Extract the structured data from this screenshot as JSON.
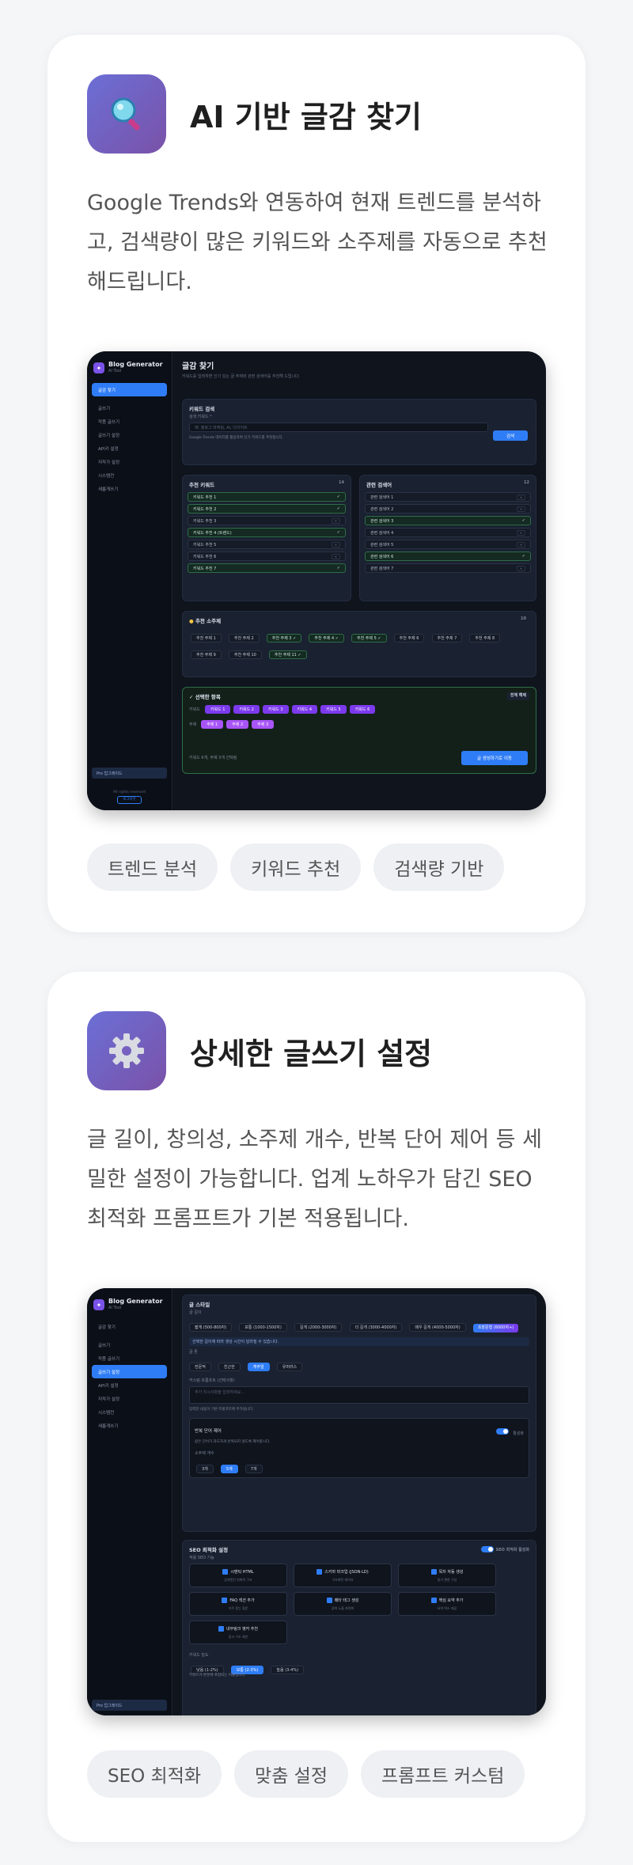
{
  "features": [
    {
      "icon": "magnifier-icon",
      "title": "AI 기반 글감 찾기",
      "description": "Google Trends와 연동하여 현재 트렌드를 분석하고, 검색량이 많은 키워드와 소주제를 자동으로 추천해드립니다.",
      "tags": [
        "트렌드 분석",
        "키워드 추천",
        "검색량 기반"
      ],
      "screenshot": {
        "app_name": "Blog Generator",
        "app_sub": "AI Tool",
        "sidebar": [
          "글감 찾기",
          "글쓰기",
          "작품 글쓰기",
          "글쓰기 설정",
          "API키 설정",
          "저작가 설정",
          "시스템전",
          "새롭게쓰기"
        ],
        "sidebar_active_index": 0,
        "sidebar_footer": "Pro 업그레이드",
        "sidebar_footer_note": "All rights reserved",
        "sidebar_footer_button": "로그아웃",
        "page_title": "글감 찾기",
        "page_subtitle": "키워드를 입력하면 인기 있는 글 주제와 관련 검색어를 추천해 드립니다.",
        "search_panel": {
          "title": "키워드 검색",
          "label": "검색 키워드 *",
          "placeholder": "예: 블로그 마케팅, AI, 다이어트",
          "button": "검색",
          "hint": "Google Trends 데이터를 활용하여 인기 키워드를 추천합니다."
        },
        "recommended": {
          "title": "추천 키워드",
          "count": "14",
          "items": [
            "키워드 추천 1",
            "키워드 추천 2",
            "키워드 추천 3",
            "키워드 추천 4 (트렌드)",
            "키워드 추천 5",
            "키워드 추천 6",
            "키워드 추천 7"
          ]
        },
        "related": {
          "title": "관련 검색어",
          "count": "12",
          "items": [
            "관련 검색어 1",
            "관련 검색어 2",
            "관련 검색어 3",
            "관련 검색어 4",
            "관련 검색어 5",
            "관련 검색어 6",
            "관련 검색어 7"
          ]
        },
        "subtopics": {
          "title": "추천 소주제",
          "count": "10",
          "items": [
            "추천 주제 1",
            "추천 주제 2",
            "추천 주제 3 ✓",
            "추천 주제 4 ✓",
            "추천 주제 5 ✓",
            "추천 주제 6",
            "추천 주제 7",
            "추천 주제 8",
            "추천 주제 9",
            "추천 주제 10",
            "추천 주제 11 ✓"
          ]
        },
        "selection": {
          "title": "선택한 항목",
          "clear": "전체 해제",
          "keyword_label": "키워드",
          "keywords": [
            "키워드 1",
            "키워드 2",
            "키워드 3",
            "키워드 4",
            "키워드 5",
            "키워드 6"
          ],
          "topic_label": "주제",
          "topics": [
            "주제 1",
            "주제 2",
            "주제 3"
          ],
          "summary": "키워드 6개, 주제 3개 선택됨",
          "generate": "글 생성하기로 이동"
        }
      }
    },
    {
      "icon": "gear-icon",
      "title": "상세한 글쓰기 설정",
      "description": "글 길이, 창의성, 소주제 개수, 반복 단어 제어 등 세밀한 설정이 가능합니다. 업계 노하우가 담긴 SEO 최적화 프롬프트가 기본 적용됩니다.",
      "tags": [
        "SEO 최적화",
        "맞춤 설정",
        "프롬프트 커스텀"
      ],
      "screenshot": {
        "app_name": "Blog Generator",
        "app_sub": "AI Tool",
        "sidebar": [
          "글감 찾기",
          "글쓰기",
          "작품 글쓰기",
          "글쓰기 설정",
          "API키 설정",
          "저작가 설정",
          "시스템전",
          "새롭게쓰기"
        ],
        "sidebar_active_index": 3,
        "sidebar_footer": "Pro 업그레이드",
        "section_title": "글 스타일",
        "length_label": "글 길이",
        "lengths": [
          "짧게 (500-800자)",
          "보통 (1000-1500자)",
          "길게 (2000-3000자)",
          "더 길게 (3000-4000자)",
          "매우 길게 (4000-5000자)",
          "초장문형 (6000자+)"
        ],
        "length_note": "선택한 길이에 따라 생성 시간이 달라질 수 있습니다.",
        "tone_label": "글 톤",
        "tones": [
          "전문적",
          "친근한",
          "캐주얼",
          "유머러스"
        ],
        "tone_active_index": 2,
        "custom_label": "커스텀 프롬프트 (선택사항)",
        "custom_placeholder": "추가 지시사항을 입력하세요...",
        "custom_hint": "입력한 내용이 기본 프롬프트에 추가됩니다.",
        "repeat_label": "반복 단어 제어",
        "repeat_toggle": "활성화",
        "repeat_desc": "같은 단어가 과도하게 반복되지 않도록 제어합니다.",
        "count_label": "소주제 개수",
        "counts": [
          "3개",
          "5개",
          "7개"
        ],
        "count_active_index": 1,
        "seo_title": "SEO 최적화 설정",
        "seo_toggle": "SEO 최적화 활성화",
        "seo_subtitle": "적용 SEO 기능",
        "seo_options": [
          {
            "name": "시맨틱 HTML",
            "desc": "검색엔진 친화적 구조"
          },
          {
            "name": "스키마 마크업 (JSON-LD)",
            "desc": "구조화된 데이터"
          },
          {
            "name": "목차 자동 생성",
            "desc": "읽기 편한 구성"
          },
          {
            "name": "FAQ 섹션 추가",
            "desc": "자주 묻는 질문"
          },
          {
            "name": "메타 태그 생성",
            "desc": "검색 노출 최적화"
          },
          {
            "name": "핵심 요약 추가",
            "desc": "요약 박스 제공"
          },
          {
            "name": "내부링크 앵커 추천",
            "desc": "링크 구조 제안"
          }
        ],
        "density_label": "키워드 밀도",
        "densities": [
          "낮음 (1-2%)",
          "보통 (2-3%)",
          "높음 (3-4%)"
        ],
        "density_active_index": 1,
        "density_hint": "키워드가 본문에 포함되는 비율입니다."
      }
    }
  ]
}
